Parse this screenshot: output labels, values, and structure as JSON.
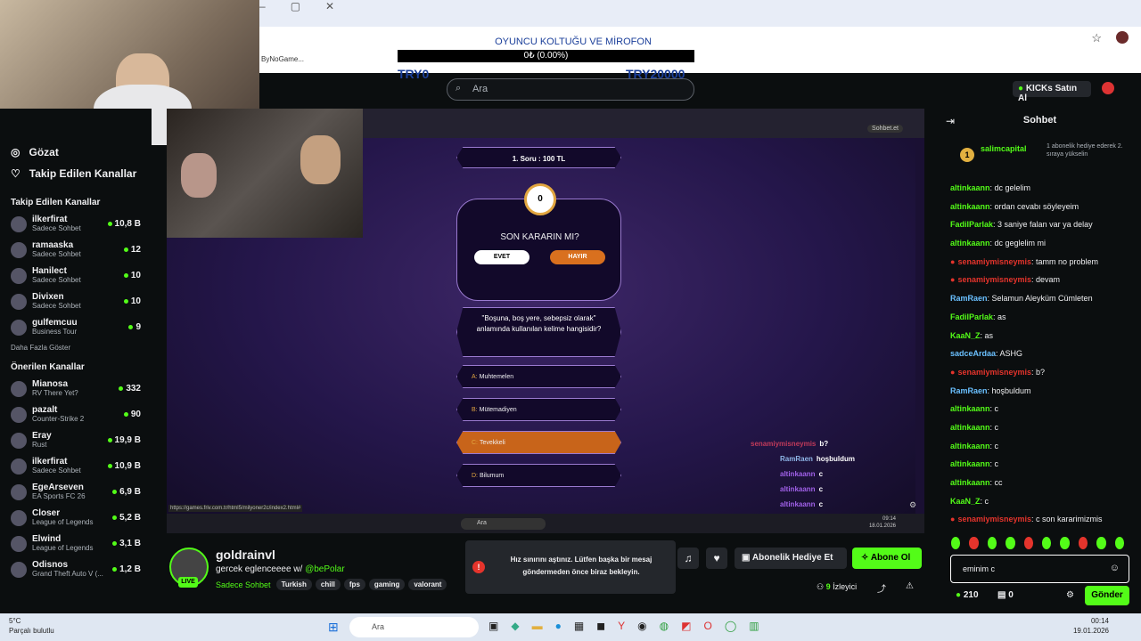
{
  "browser": {
    "tab_text": "ByNoGame...",
    "donation": {
      "title": "OYUNCU KOLTUĞU VE MİROFON",
      "progress_text": "0₺ (0.00%)",
      "left": "TRY0",
      "right": "TRY20000"
    }
  },
  "nav": {
    "search_placeholder": "Ara",
    "kicks_label": "KICKs Satın Al"
  },
  "sidebar": {
    "browse": "Gözat",
    "following": "Takip Edilen Kanallar",
    "followed_header": "Takip Edilen Kanallar",
    "followed": [
      {
        "name": "ilkerfirat",
        "sub": "Sadece Sohbet",
        "count": "10,8 B"
      },
      {
        "name": "ramaaska",
        "sub": "Sadece Sohbet",
        "count": "12"
      },
      {
        "name": "Hanilect",
        "sub": "Sadece Sohbet",
        "count": "10"
      },
      {
        "name": "Divixen",
        "sub": "Sadece Sohbet",
        "count": "10"
      },
      {
        "name": "gulfemcuu",
        "sub": "Business Tour",
        "count": "9"
      }
    ],
    "show_more": "Daha Fazla Göster",
    "recommended_header": "Önerilen Kanallar",
    "recommended": [
      {
        "name": "Mianosa",
        "sub": "RV There Yet?",
        "count": "332"
      },
      {
        "name": "pazalt",
        "sub": "Counter-Strike 2",
        "count": "90"
      },
      {
        "name": "Eray",
        "sub": "Rust",
        "count": "19,9 B"
      },
      {
        "name": "ilkerfirat",
        "sub": "Sadece Sohbet",
        "count": "10,9 B"
      },
      {
        "name": "EgeArseven",
        "sub": "EA Sports FC 26",
        "count": "6,9 B"
      },
      {
        "name": "Closer",
        "sub": "League of Legends",
        "count": "5,2 B"
      },
      {
        "name": "Elwind",
        "sub": "League of Legends",
        "count": "3,1 B"
      },
      {
        "name": "Odisnos",
        "sub": "Grand Theft Auto V (...",
        "count": "1,2 B"
      }
    ]
  },
  "game": {
    "question_no": "1. Soru : 100 TL",
    "timer": "0",
    "confirm_title": "SON KARARIN MI?",
    "yes": "EVET",
    "no": "HAYIR",
    "question": "\"Boşuna, boş yere, sebepsiz olarak\" anlamında kullanılan kelime hangisidir?",
    "answers": [
      {
        "key": "A:",
        "text": "Muhtemelen"
      },
      {
        "key": "B:",
        "text": "Mütemadiyen"
      },
      {
        "key": "C:",
        "text": "Tevekkeli"
      },
      {
        "key": "D:",
        "text": "Bilumum"
      }
    ],
    "status_url": "https://games.friv.com.tr/html5/milyoner2c/index2.html#",
    "overlay_chat": [
      {
        "user": "senamiymisneymis",
        "text": "b?"
      },
      {
        "user": "RamRaen",
        "text": "hoşbuldum"
      },
      {
        "user": "altinkaann",
        "text": "c"
      },
      {
        "user": "altinkaann",
        "text": "c"
      },
      {
        "user": "altinkaann",
        "text": "c"
      }
    ],
    "inner_tab": "Sohbet.et",
    "inner_search": "Ara",
    "inner_time": "09:14",
    "inner_date": "18.01.2026"
  },
  "channel": {
    "name": "goldrainvl",
    "live": "LIVE",
    "title_prefix": "gercek eglenceeee w/ ",
    "title_mention": "@bePolar",
    "category": "Sadece Sohbet",
    "tags": [
      "Turkish",
      "chill",
      "fps",
      "gaming",
      "valorant"
    ],
    "toast": "Hız sınırını aştınız. Lütfen başka bir mesaj göndermeden önce biraz bekleyin.",
    "gift_label": "Abonelik Hediye Et",
    "subscribe_label": "Abone Ol",
    "viewers": "9",
    "viewers_label": "İzleyici"
  },
  "chat": {
    "title": "Sohbet",
    "pinned_user": "salimcapital",
    "pinned_text": "1 abonelik hediye ederek 2. sıraya yükselin",
    "messages": [
      {
        "user": "altinkaann",
        "cls": "u-g",
        "text": ": dc gelelim"
      },
      {
        "user": "altinkaann",
        "cls": "u-g",
        "text": ": ordan cevabı söyleyeim"
      },
      {
        "user": "FadilParlak",
        "cls": "u-g",
        "text": ": 3 saniye falan var ya delay"
      },
      {
        "user": "altinkaann",
        "cls": "u-g",
        "text": ": dc geglelim mi"
      },
      {
        "user": "senamiymisneymis",
        "cls": "u-r",
        "text": ": tamm no problem"
      },
      {
        "user": "senamiymisneymis",
        "cls": "u-r",
        "text": ": devam"
      },
      {
        "user": "RamRaen",
        "cls": "u-b",
        "text": ": Selamun Aleyküm Cümleten"
      },
      {
        "user": "FadilParlak",
        "cls": "u-g",
        "text": ": as"
      },
      {
        "user": "KaaN_Z",
        "cls": "u-g",
        "text": ": as"
      },
      {
        "user": "sadceArdaa",
        "cls": "u-b",
        "text": ": ASHG"
      },
      {
        "user": "senamiymisneymis",
        "cls": "u-r",
        "text": ": b?"
      },
      {
        "user": "RamRaen",
        "cls": "u-b",
        "text": ": hoşbuldum"
      },
      {
        "user": "altinkaann",
        "cls": "u-g",
        "text": ": c"
      },
      {
        "user": "altinkaann",
        "cls": "u-g",
        "text": ": c"
      },
      {
        "user": "altinkaann",
        "cls": "u-g",
        "text": ": c"
      },
      {
        "user": "altinkaann",
        "cls": "u-g",
        "text": ": c"
      },
      {
        "user": "altinkaann",
        "cls": "u-g",
        "text": ": cc"
      },
      {
        "user": "KaaN_Z",
        "cls": "u-g",
        "text": ": c"
      },
      {
        "user": "senamiymisneymis",
        "cls": "u-r",
        "text": ": c son kararimizmis"
      }
    ],
    "input_value": "eminim c",
    "kicks_count": "210",
    "other_count": "0",
    "send_label": "Gönder"
  },
  "taskbar": {
    "weather_temp": "5°C",
    "weather_text": "Parçalı bulutlu",
    "search": "Ara",
    "time": "00:14",
    "date": "19.01.2026"
  }
}
